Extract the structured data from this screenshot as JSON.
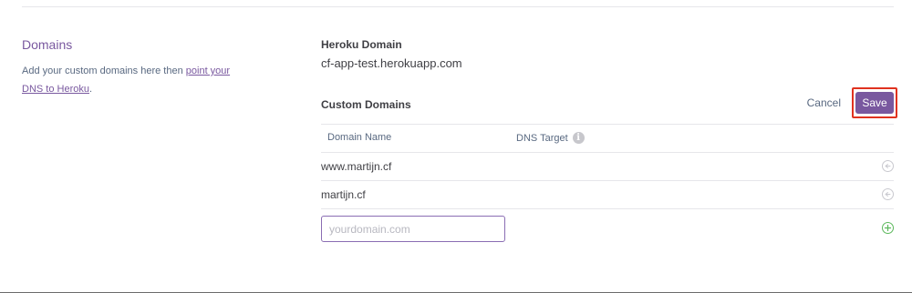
{
  "domains_section": {
    "title": "Domains",
    "desc_prefix": "Add your custom domains here then ",
    "link_text": "point your DNS to Heroku",
    "desc_suffix": "."
  },
  "heroku_domain": {
    "label": "Heroku Domain",
    "value": "cf-app-test.herokuapp.com"
  },
  "custom_domains": {
    "title": "Custom Domains",
    "cancel_label": "Cancel",
    "save_label": "Save",
    "columns": [
      "Domain Name",
      "DNS Target"
    ],
    "rows": [
      {
        "domain": "www.martijn.cf"
      },
      {
        "domain": "martijn.cf"
      }
    ],
    "new_domain_placeholder": "yourdomain.com",
    "new_domain_value": ""
  },
  "colors": {
    "accent": "#79589f",
    "highlight": "#e0321f",
    "add_green": "#5cb85c"
  },
  "icons": {
    "info": "info-icon",
    "remove": "remove-icon",
    "add": "add-icon"
  }
}
